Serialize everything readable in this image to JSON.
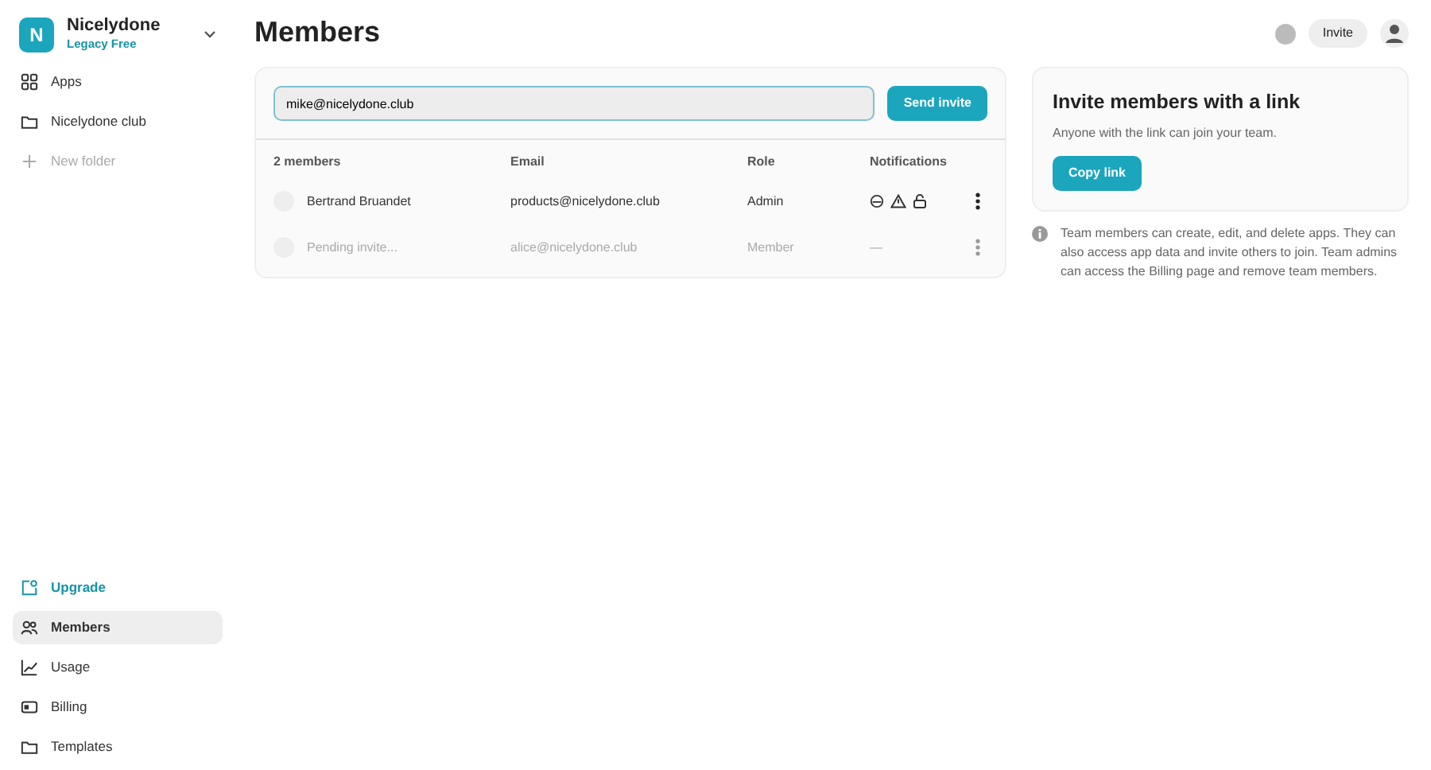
{
  "workspace": {
    "initial": "N",
    "name": "Nicelydone",
    "plan": "Legacy Free"
  },
  "sidebar": {
    "top_items": [
      {
        "kind": "apps",
        "label": "Apps",
        "selected": false
      },
      {
        "kind": "folder",
        "label": "Nicelydone club",
        "selected": false
      },
      {
        "kind": "add",
        "label": "New folder",
        "selected": false
      }
    ],
    "bottom_items": [
      {
        "kind": "upgrade",
        "label": "Upgrade",
        "selected": false
      },
      {
        "kind": "members",
        "label": "Members",
        "selected": true
      },
      {
        "kind": "usage",
        "label": "Usage",
        "selected": false
      },
      {
        "kind": "billing",
        "label": "Billing",
        "selected": false
      },
      {
        "kind": "templates",
        "label": "Templates",
        "selected": false
      }
    ]
  },
  "page_title": "Members",
  "header": {
    "invite_button": "Invite"
  },
  "invite_form": {
    "value": "mike@nicelydone.club",
    "button": "Send invite"
  },
  "table": {
    "columns": [
      "2 members",
      "Email",
      "Role",
      "Notifications"
    ],
    "rows": [
      {
        "name": "Bertrand Bruandet",
        "email": "products@nicelydone.club",
        "role": "Admin",
        "pending": false
      },
      {
        "name": "Pending invite...",
        "email": "alice@nicelydone.club",
        "role": "Member",
        "notifications": "—",
        "pending": true
      }
    ]
  },
  "link_card": {
    "title": "Invite members with a link",
    "text": "Anyone with the link can join your team.",
    "button": "Copy link"
  },
  "info_note": "Team members can create, edit, and delete apps. They can also access app data and invite others to join. Team admins can access the Billing page and remove team members."
}
